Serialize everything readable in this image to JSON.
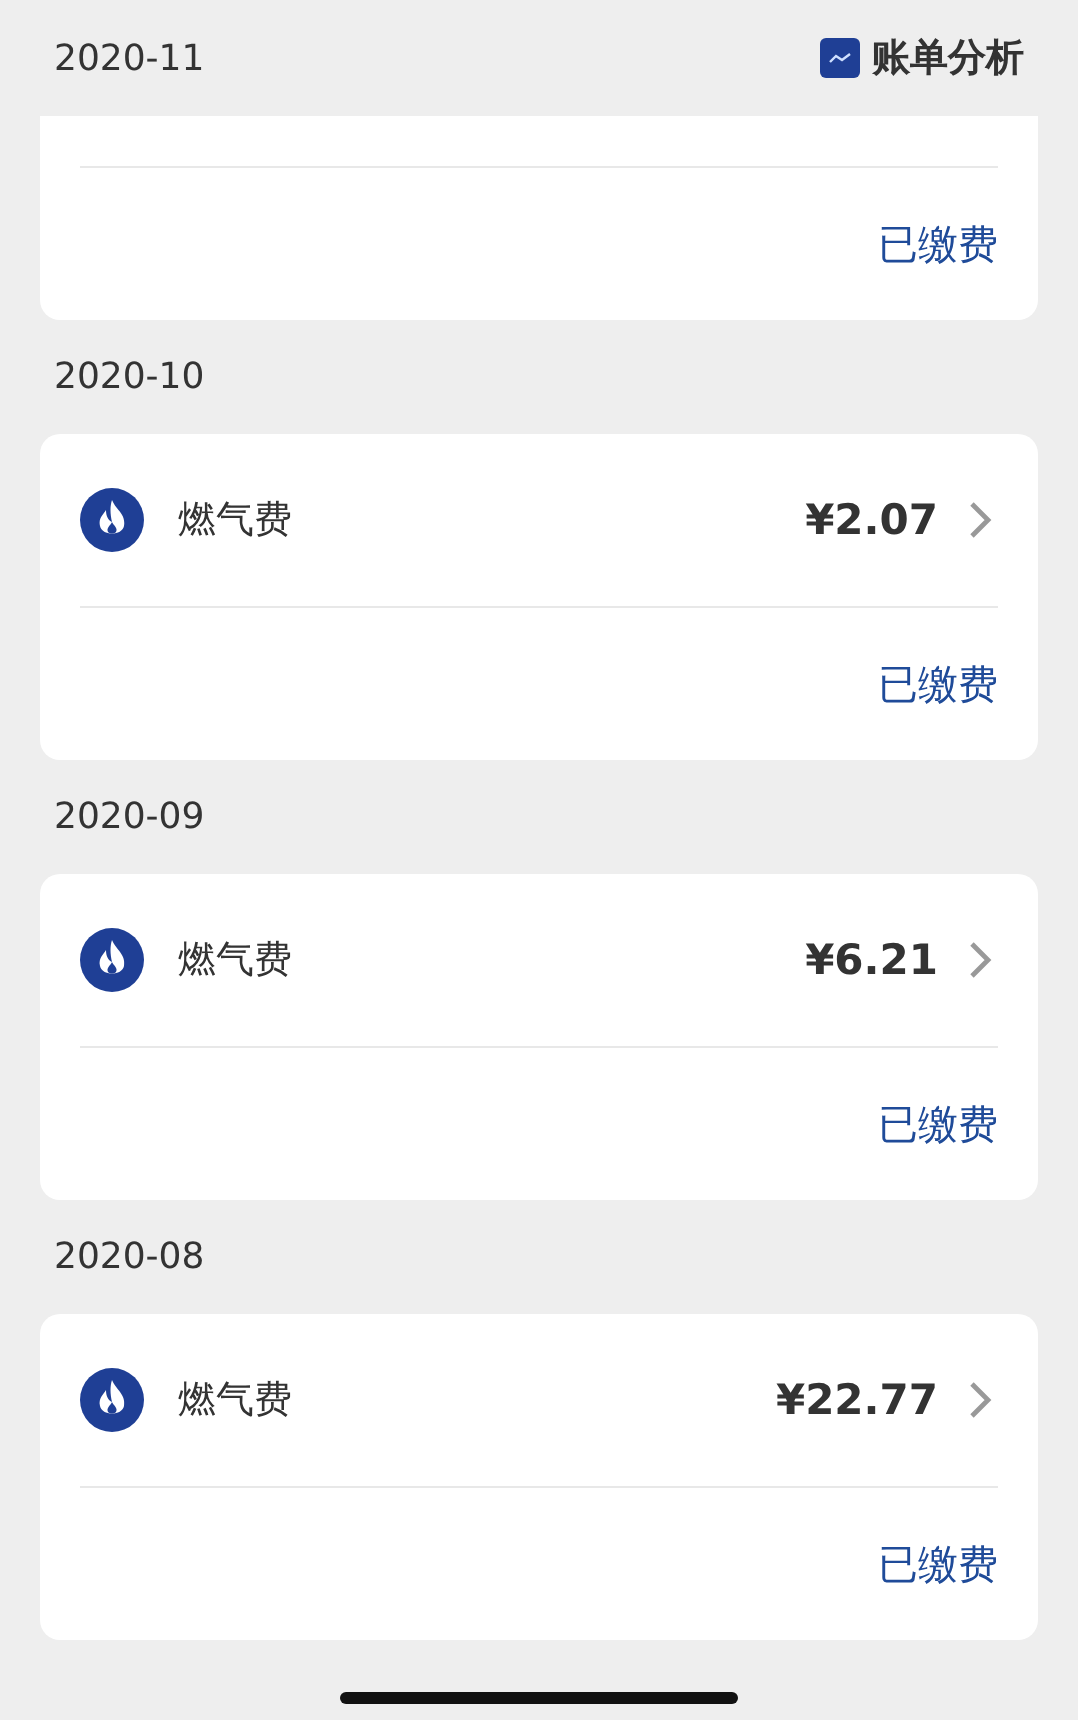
{
  "header": {
    "month": "2020-11",
    "analysis_label": "账单分析"
  },
  "partial_card": {
    "status": "已缴费"
  },
  "groups": [
    {
      "month": "2020-10",
      "name": "燃气费",
      "amount": "¥2.07",
      "status": "已缴费"
    },
    {
      "month": "2020-09",
      "name": "燃气费",
      "amount": "¥6.21",
      "status": "已缴费"
    },
    {
      "month": "2020-08",
      "name": "燃气费",
      "amount": "¥22.77",
      "status": "已缴费"
    }
  ]
}
